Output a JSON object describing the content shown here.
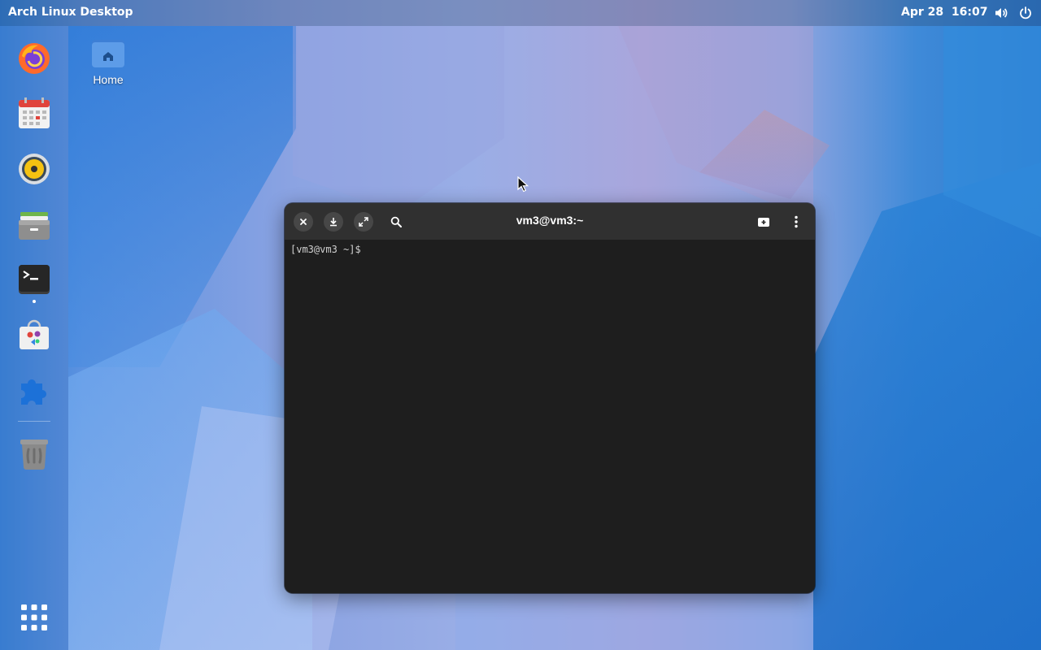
{
  "topbar": {
    "title": "Arch Linux Desktop",
    "clock": "Apr 28  16:07",
    "icons": [
      "volume-icon",
      "power-icon"
    ]
  },
  "dock": {
    "items": [
      {
        "name": "firefox",
        "icon": "firefox-icon",
        "running": false
      },
      {
        "name": "calendar",
        "icon": "calendar-icon",
        "running": false
      },
      {
        "name": "rhythmbox",
        "icon": "speaker-icon",
        "running": false
      },
      {
        "name": "files",
        "icon": "file-cabinet-icon",
        "running": false
      },
      {
        "name": "terminal",
        "icon": "terminal-icon",
        "running": true
      },
      {
        "name": "software",
        "icon": "software-store-icon",
        "running": false
      },
      {
        "name": "extensions",
        "icon": "puzzle-piece-icon",
        "running": false
      },
      {
        "name": "trash",
        "icon": "trash-icon",
        "running": false
      }
    ],
    "app_grid_icon": "app-grid-icon"
  },
  "desktop": {
    "home_label": "Home"
  },
  "terminal": {
    "title": "vm3@vm3:~",
    "prompt": "[vm3@vm3 ~]$",
    "header_buttons": [
      "close-icon",
      "download-icon",
      "maximize-icon",
      "search-icon",
      "new-tab-icon",
      "menu-icon"
    ]
  },
  "colors": {
    "terminal_bg": "#1e1e1e",
    "header_bg": "#303030",
    "accent_blue": "#3584e4"
  }
}
